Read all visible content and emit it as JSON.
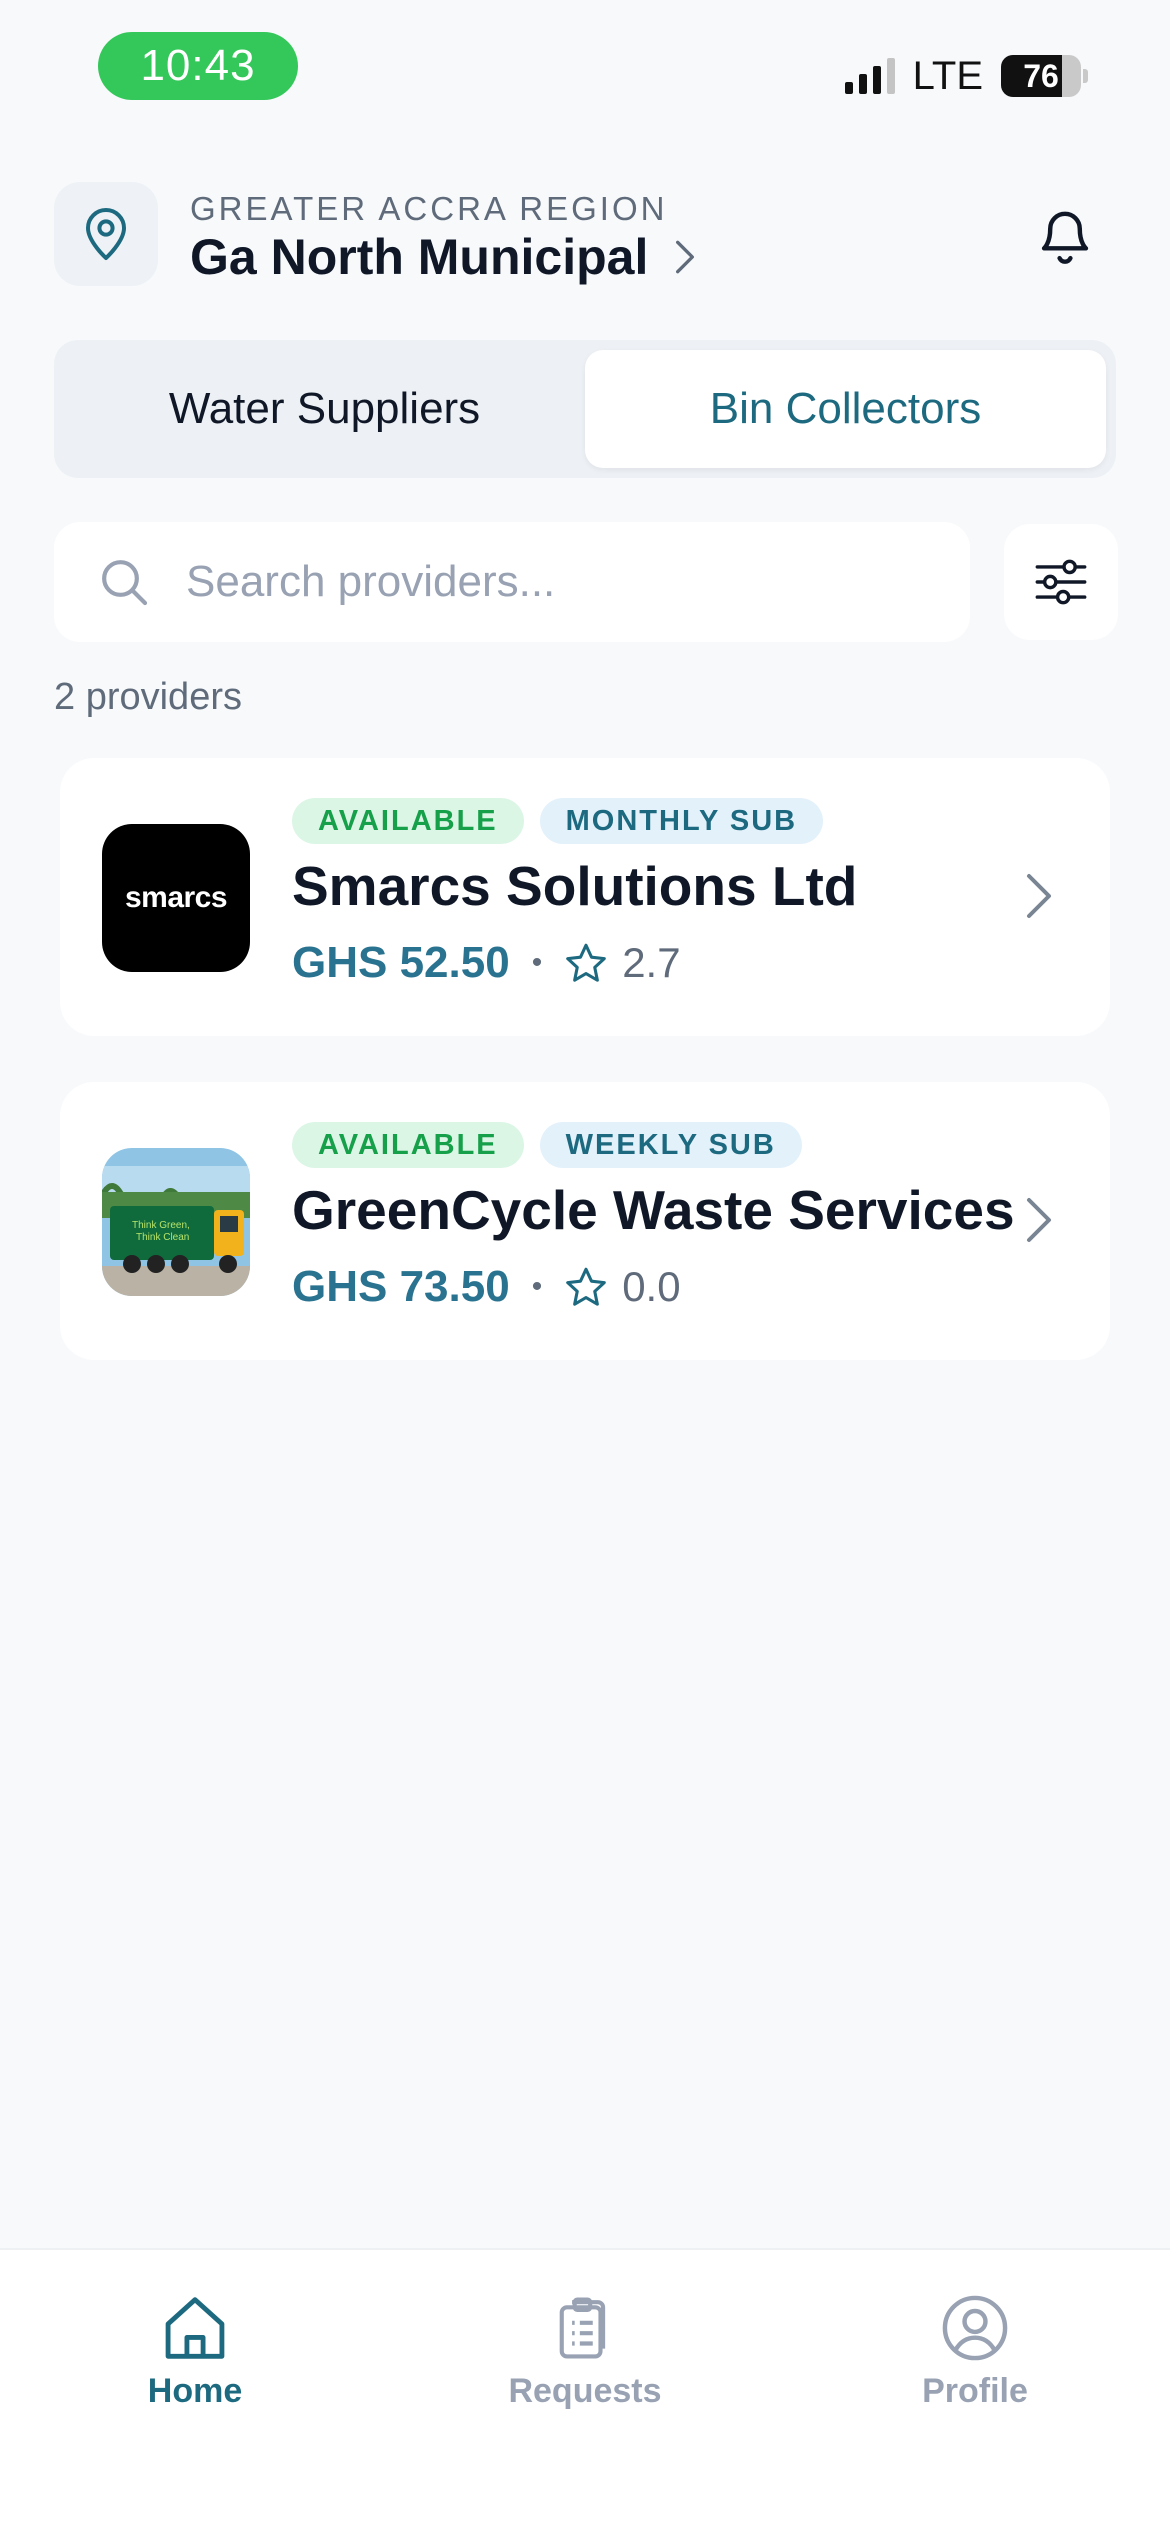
{
  "status_bar": {
    "time": "10:43",
    "network": "LTE",
    "battery": "76",
    "battery_level": 0.76
  },
  "header": {
    "location_icon": "map-pin-icon",
    "region": "GREATER ACCRA REGION",
    "district": "Ga North Municipal",
    "notification_icon": "bell-icon"
  },
  "tabs": [
    {
      "label": "Water Suppliers",
      "active": false
    },
    {
      "label": "Bin Collectors",
      "active": true
    }
  ],
  "search": {
    "placeholder": "Search providers...",
    "value": "",
    "filter_icon": "sliders-icon"
  },
  "provider_count": "2 providers",
  "providers": [
    {
      "logo_text": "smarcs",
      "badges": [
        "AVAILABLE",
        "MONTHLY SUB"
      ],
      "name": "Smarcs Solutions Ltd",
      "price": "GHS 52.50",
      "separator": "•",
      "rating": "2.7"
    },
    {
      "logo": "garbage-truck-photo",
      "badges": [
        "AVAILABLE",
        "WEEKLY SUB"
      ],
      "name": "GreenCycle Waste Services",
      "price": "GHS 73.50",
      "separator": "•",
      "rating": "0.0"
    }
  ],
  "bottom_nav": [
    {
      "label": "Home",
      "icon": "home-icon",
      "active": true
    },
    {
      "label": "Requests",
      "icon": "clipboard-icon",
      "active": false
    },
    {
      "label": "Profile",
      "icon": "user-circle-icon",
      "active": false
    }
  ],
  "colors": {
    "accent": "#1d6a80",
    "price": "#2a7390",
    "available": "#17a04a",
    "status_green": "#34c759"
  }
}
